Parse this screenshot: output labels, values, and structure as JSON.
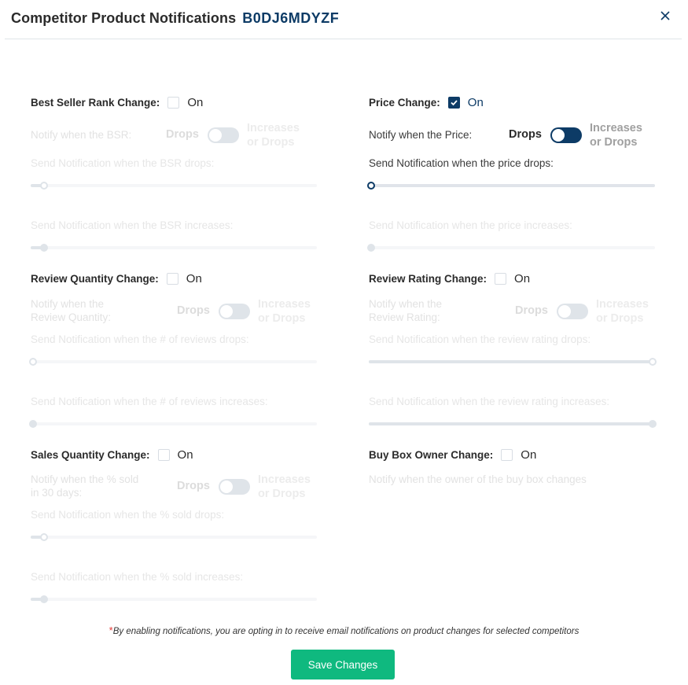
{
  "header": {
    "title": "Competitor Product Notifications",
    "asin": "B0DJ6MDYZF",
    "close_icon": "close-icon"
  },
  "on_label": "On",
  "toggle": {
    "drops_label": "Drops",
    "increases_label_line1": "Increases",
    "increases_label_line2": "or Drops"
  },
  "sections": {
    "bsr": {
      "title": "Best Seller Rank Change:",
      "checked": false,
      "notify_label_line1": "Notify when the BSR:",
      "notify_label_line2": "",
      "toggle_value": "Drops",
      "drop_label": "Send Notification when the BSR drops:",
      "drop_value_pct": 4,
      "increase_label": "Send Notification when the BSR increases:",
      "increase_value_pct": 4
    },
    "price": {
      "title": "Price Change:",
      "checked": true,
      "notify_label_line1": "Notify when the Price:",
      "notify_label_line2": "",
      "toggle_value": "Drops",
      "drop_label": "Send Notification when the price drops:",
      "drop_value_pct": 0,
      "increase_label": "Send Notification when the price increases:",
      "increase_value_pct": 0
    },
    "review_qty": {
      "title": "Review Quantity Change:",
      "checked": false,
      "notify_label_line1": "Notify when the",
      "notify_label_line2": "Review Quantity:",
      "toggle_value": "Drops",
      "drop_label": "Send Notification when the # of reviews drops:",
      "drop_value_pct": 0,
      "increase_label": "Send Notification when the # of reviews increases:",
      "increase_value_pct": 0
    },
    "review_rating": {
      "title": "Review Rating Change:",
      "checked": false,
      "notify_label_line1": "Notify when the",
      "notify_label_line2": "Review Rating:",
      "toggle_value": "Drops",
      "drop_label": "Send Notification when the review rating drops:",
      "drop_value_pct": 100,
      "increase_label": "Send Notification when the review rating increases:",
      "increase_value_pct": 100
    },
    "sales_qty": {
      "title": "Sales Quantity Change:",
      "checked": false,
      "notify_label_line1": "Notify when the % sold",
      "notify_label_line2": "in 30 days:",
      "toggle_value": "Drops",
      "drop_label": "Send Notification when the % sold drops:",
      "drop_value_pct": 4,
      "increase_label": "Send Notification when the % sold increases:",
      "increase_value_pct": 4
    },
    "buy_box": {
      "title": "Buy Box Owner Change:",
      "checked": false,
      "note": "Notify when the owner of the buy box changes"
    }
  },
  "footer": {
    "asterisk": "*",
    "note": "By enabling notifications, you are opting in to receive email notifications on product changes for selected competitors",
    "save_label": "Save Changes"
  },
  "colors": {
    "brand": "#0d3b66",
    "save_button": "#0fb97f",
    "asterisk": "#e53935"
  }
}
